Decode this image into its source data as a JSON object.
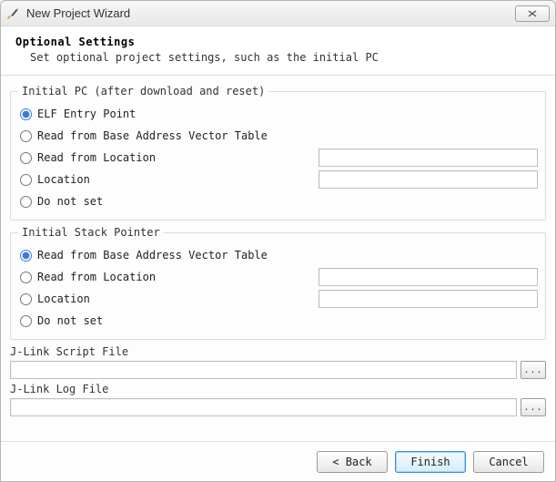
{
  "window": {
    "title": "New Project Wizard"
  },
  "header": {
    "title": "Optional Settings",
    "subtitle": "Set optional project settings, such as the initial PC"
  },
  "initial_pc": {
    "legend": "Initial PC (after download and reset)",
    "options": {
      "elf": "ELF Entry Point",
      "base": "Read from Base Address Vector Table",
      "readloc": "Read from Location",
      "loc": "Location",
      "none": "Do not set"
    },
    "values": {
      "readloc": "",
      "loc": ""
    }
  },
  "initial_sp": {
    "legend": "Initial Stack Pointer",
    "options": {
      "base": "Read from Base Address Vector Table",
      "readloc": "Read from Location",
      "loc": "Location",
      "none": "Do not set"
    },
    "values": {
      "readloc": "",
      "loc": ""
    }
  },
  "script": {
    "label": "J-Link Script File",
    "value": "",
    "browse": "..."
  },
  "log": {
    "label": "J-Link Log File",
    "value": "",
    "browse": "..."
  },
  "footer": {
    "back": "< Back",
    "finish": "Finish",
    "cancel": "Cancel"
  }
}
